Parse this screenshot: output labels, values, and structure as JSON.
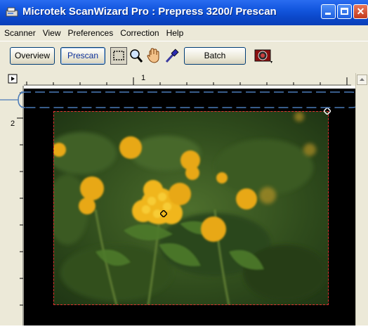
{
  "window": {
    "title": "Microtek ScanWizard Pro : Prepress 3200/ Prescan",
    "colors": {
      "titlebar": "#0b47c9",
      "chrome": "#ece9d8",
      "preview_bg": "#000000",
      "scan_frame": "#e03030"
    }
  },
  "menu": {
    "items": [
      "Scanner",
      "View",
      "Preferences",
      "Correction",
      "Help"
    ]
  },
  "toolbar": {
    "overview_label": "Overview",
    "prescan_label": "Prescan",
    "batch_label": "Batch",
    "tools": [
      "select-rectangle-icon",
      "magnifier-icon",
      "hand-icon",
      "eyedropper-icon"
    ],
    "camera_icon": "scanner-camera-icon"
  },
  "rulers": {
    "horizontal_label": "1",
    "vertical_label": "2"
  },
  "preview": {
    "image_description_icon": "flower-photo"
  }
}
